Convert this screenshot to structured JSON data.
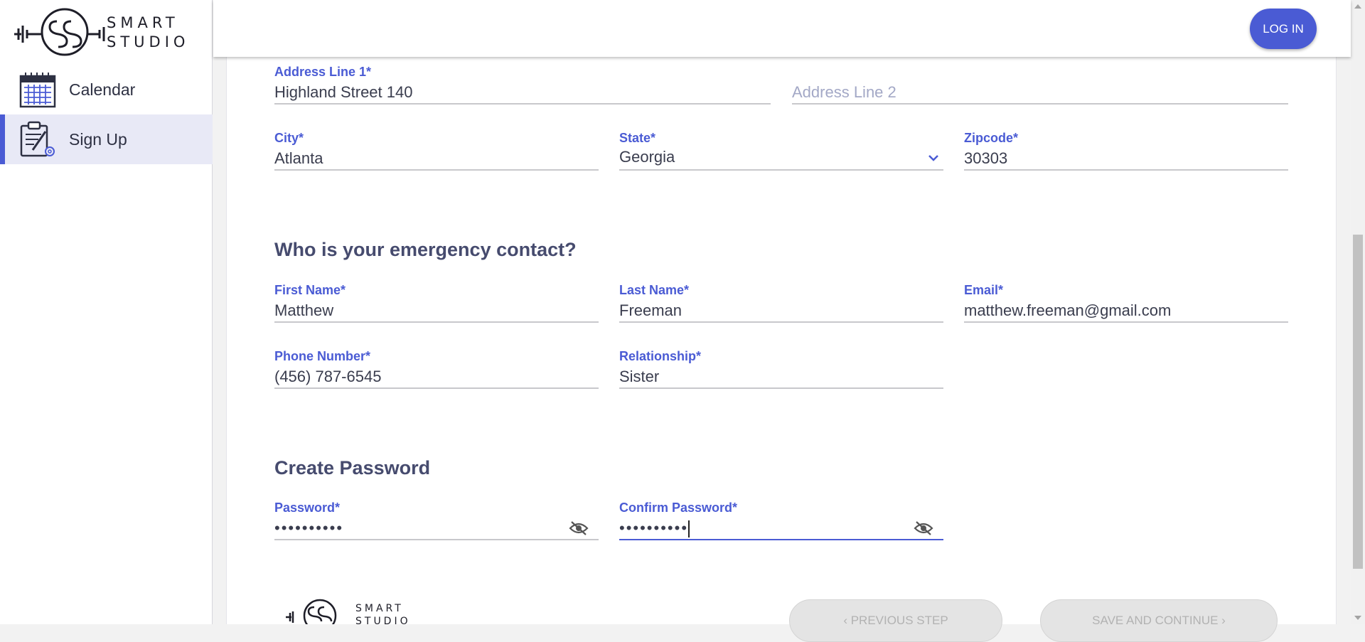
{
  "sidebar": {
    "logo_text_line1": "SMART",
    "logo_text_line2": "STUDIO",
    "items": [
      {
        "label": "Calendar",
        "icon": "calendar-icon"
      },
      {
        "label": "Sign Up",
        "icon": "clipboard-gear-icon",
        "active": true
      }
    ]
  },
  "header": {
    "login_label": "LOG IN"
  },
  "address": {
    "line1": {
      "label": "Address Line 1*",
      "value": "Highland Street 140"
    },
    "line2": {
      "placeholder": "Address Line 2"
    },
    "city": {
      "label": "City*",
      "value": "Atlanta"
    },
    "state": {
      "label": "State*",
      "value": "Georgia"
    },
    "zipcode": {
      "label": "Zipcode*",
      "value": "30303"
    }
  },
  "emergency": {
    "heading": "Who is your emergency contact?",
    "first_name": {
      "label": "First Name*",
      "value": "Matthew"
    },
    "last_name": {
      "label": "Last Name*",
      "value": "Freeman"
    },
    "email": {
      "label": "Email*",
      "value": "matthew.freeman@gmail.com"
    },
    "phone": {
      "label": "Phone Number*",
      "value": "(456) 787-6545"
    },
    "relationship": {
      "label": "Relationship*",
      "value": "Sister"
    }
  },
  "password": {
    "heading": "Create Password",
    "password": {
      "label": "Password*",
      "value": "••••••••••"
    },
    "confirm": {
      "label": "Confirm Password*",
      "value": "••••••••••"
    }
  },
  "footer": {
    "prev_label": "‹  PREVIOUS STEP",
    "save_label": "SAVE AND CONTINUE  ›"
  },
  "colors": {
    "accent": "#4a5bd4",
    "active_nav_bg": "#e8e9f6"
  }
}
